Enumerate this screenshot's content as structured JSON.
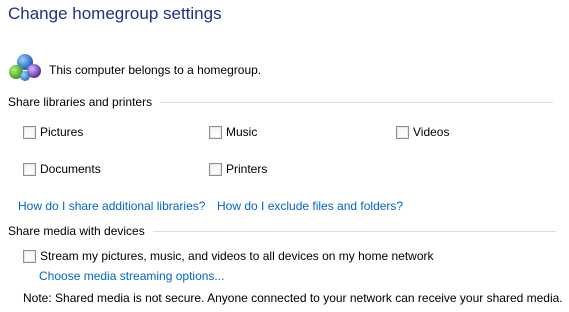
{
  "page_title": "Change homegroup settings",
  "status": {
    "icon": "homegroup-icon",
    "text": "This computer belongs to a homegroup."
  },
  "share_libraries": {
    "heading": "Share libraries and printers",
    "items": [
      {
        "label": "Pictures",
        "checked": false
      },
      {
        "label": "Music",
        "checked": false
      },
      {
        "label": "Videos",
        "checked": false
      },
      {
        "label": "Documents",
        "checked": false
      },
      {
        "label": "Printers",
        "checked": false
      }
    ],
    "links": {
      "additional_libraries": "How do I share additional libraries?",
      "exclude_files": "How do I exclude files and folders?"
    }
  },
  "share_media": {
    "heading": "Share media with devices",
    "stream_label": "Stream my pictures, music, and videos to all devices on my home network",
    "stream_checked": false,
    "options_link": "Choose media streaming options...",
    "note": "Note: Shared media is not secure. Anyone connected to your network can receive your shared media."
  },
  "colors": {
    "title": "#1e3287",
    "link": "#0066cc",
    "section_line": "#d5dfe5"
  }
}
